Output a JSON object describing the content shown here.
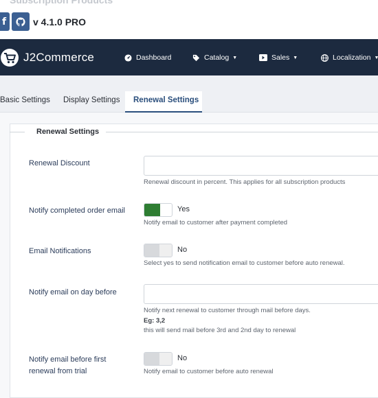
{
  "header": {
    "cut_title": "Subscription Products",
    "version": "v 4.1.0 PRO"
  },
  "navbar": {
    "brand": "J2Commerce",
    "items": [
      {
        "label": "Dashboard",
        "icon": "dashboard-icon"
      },
      {
        "label": "Catalog",
        "icon": "tag-icon"
      },
      {
        "label": "Sales",
        "icon": "video-icon"
      },
      {
        "label": "Localization",
        "icon": "globe-icon"
      }
    ]
  },
  "tabs": [
    {
      "label": "Basic Settings"
    },
    {
      "label": "Display Settings"
    },
    {
      "label": "Renewal Settings",
      "active": true
    }
  ],
  "form": {
    "legend": "Renewal Settings",
    "renewal_discount": {
      "label": "Renewal Discount",
      "value": "",
      "help": "Renewal discount in percent. This applies for all subscription products"
    },
    "notify_completed": {
      "label": "Notify completed order email",
      "state": "Yes",
      "help": "Notify email to customer after payment completed"
    },
    "email_notifications": {
      "label": "Email Notifications",
      "state": "No",
      "help": "Select yes to send notification email to customer before auto renewal."
    },
    "notify_day_before": {
      "label": "Notify email on day before",
      "value": "",
      "help1": "Notify next renewal to customer through mail before days.",
      "help2": "Eg: 3,2",
      "help3": "this will send mail before 3rd and 2nd day to renewal"
    },
    "notify_first_renewal": {
      "label_line1": "Notify email before first",
      "label_line2": "renewal from trial",
      "state": "No",
      "help": "Notify email to customer before auto renewal"
    }
  },
  "colors": {
    "navbar": "#1c2a3f",
    "accent": "#2a4e7c",
    "toggle_on": "#2e7d32"
  }
}
